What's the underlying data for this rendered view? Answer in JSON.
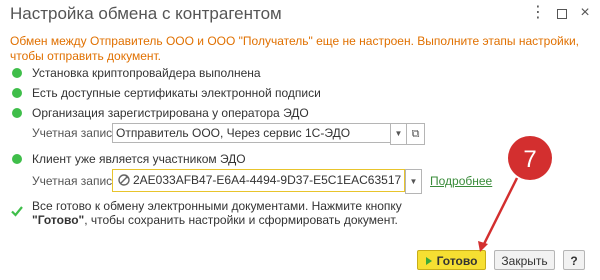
{
  "window": {
    "title": "Настройка обмена с контрагентом",
    "more_glyph": "⋮",
    "close_glyph": "×"
  },
  "notice": "Обмен между Отправитель ООО и ООО \"Получатель\" еще не настроен. Выполните этапы настройки, чтобы отправить документ.",
  "steps": [
    {
      "label": "Установка криптопровайдера выполнена"
    },
    {
      "label": "Есть доступные сертификаты электронной подписи"
    },
    {
      "label": "Организация зарегистрирована у оператора ЭДО"
    },
    {
      "label": "Клиент уже является участником ЭДО"
    }
  ],
  "account1": {
    "label": "Учетная запись:",
    "value": "Отправитель ООО, Через сервис 1С-ЭДО"
  },
  "account2": {
    "label": "Учетная запись:",
    "value": "2AE033AFB47-E6A4-4494-9D37-E5C1EAC63517",
    "details_link": "Подробнее"
  },
  "final_message": {
    "line1": "Все готово к обмену электронными документами. Нажмите кнопку",
    "bold": "\"Готово\"",
    "line2_rest": ", чтобы сохранить настройки и сформировать документ."
  },
  "buttons": {
    "done": "Готово",
    "close": "Закрыть",
    "help": "?"
  },
  "annotation": {
    "number": "7",
    "color": "#d32f2f"
  },
  "colors": {
    "accent_yellow": "#f6df32",
    "ok_green": "#3fbe4a",
    "notice_orange": "#e07000",
    "link_green": "#3a8c3a"
  }
}
